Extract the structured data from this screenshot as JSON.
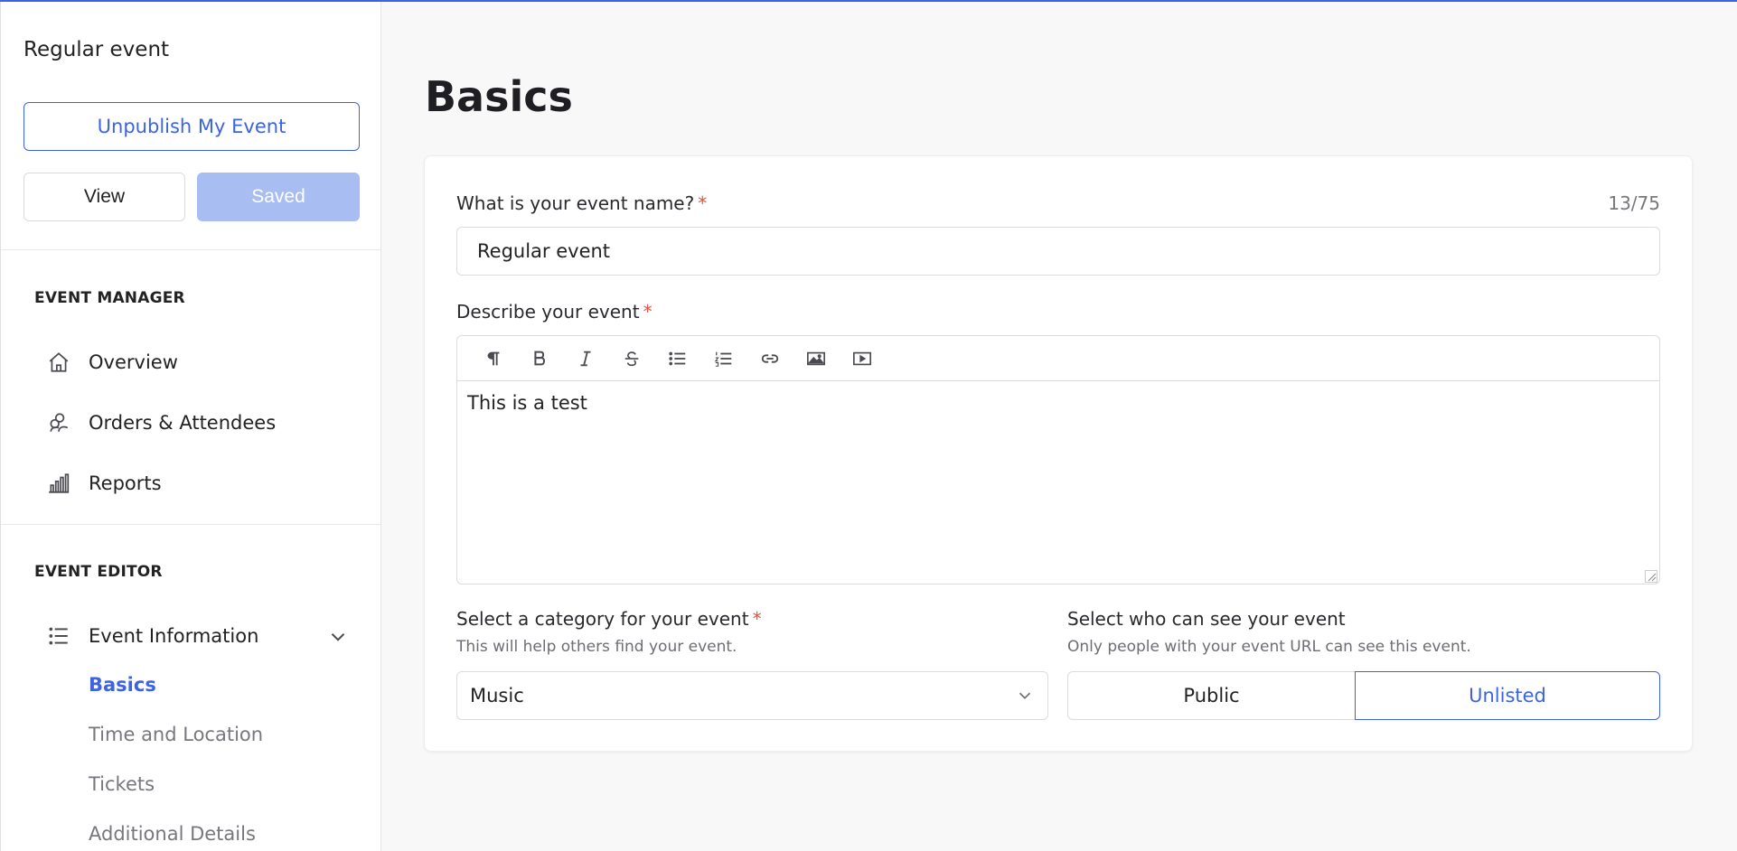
{
  "sidebar": {
    "event_title": "Regular event",
    "unpublish_label": "Unpublish My Event",
    "view_label": "View",
    "saved_label": "Saved",
    "manager_heading": "EVENT MANAGER",
    "manager_items": [
      {
        "label": "Overview",
        "icon": "home-icon"
      },
      {
        "label": "Orders & Attendees",
        "icon": "attendees-icon"
      },
      {
        "label": "Reports",
        "icon": "bar-chart-icon"
      }
    ],
    "editor_heading": "EVENT EDITOR",
    "editor_group": {
      "label": "Event Information",
      "icon": "list-icon",
      "expanded": true
    },
    "editor_sub_items": [
      {
        "label": "Basics",
        "active": true
      },
      {
        "label": "Time and Location",
        "active": false
      },
      {
        "label": "Tickets",
        "active": false
      },
      {
        "label": "Additional Details",
        "active": false
      }
    ]
  },
  "main": {
    "page_title": "Basics",
    "name_field": {
      "label": "What is your event name?",
      "required_mark": "*",
      "value": "Regular event",
      "counter": "13/75"
    },
    "description": {
      "label": "Describe your event",
      "required_mark": "*",
      "toolbar": [
        "paragraph-icon",
        "bold-icon",
        "italic-icon",
        "strikethrough-icon",
        "bullet-list-icon",
        "numbered-list-icon",
        "link-icon",
        "image-icon",
        "video-icon"
      ],
      "content": "This is a test"
    },
    "category": {
      "label": "Select a category for your event",
      "required_mark": "*",
      "hint": "This will help others find your event.",
      "selected": "Music"
    },
    "visibility": {
      "label": "Select who can see your event",
      "hint": "Only people with your event URL can see this event.",
      "options": [
        "Public",
        "Unlisted"
      ],
      "selected": "Unlisted"
    }
  },
  "colors": {
    "accent": "#3d64e0",
    "saved_button": "#a8bdf2",
    "required": "#e2513f"
  }
}
